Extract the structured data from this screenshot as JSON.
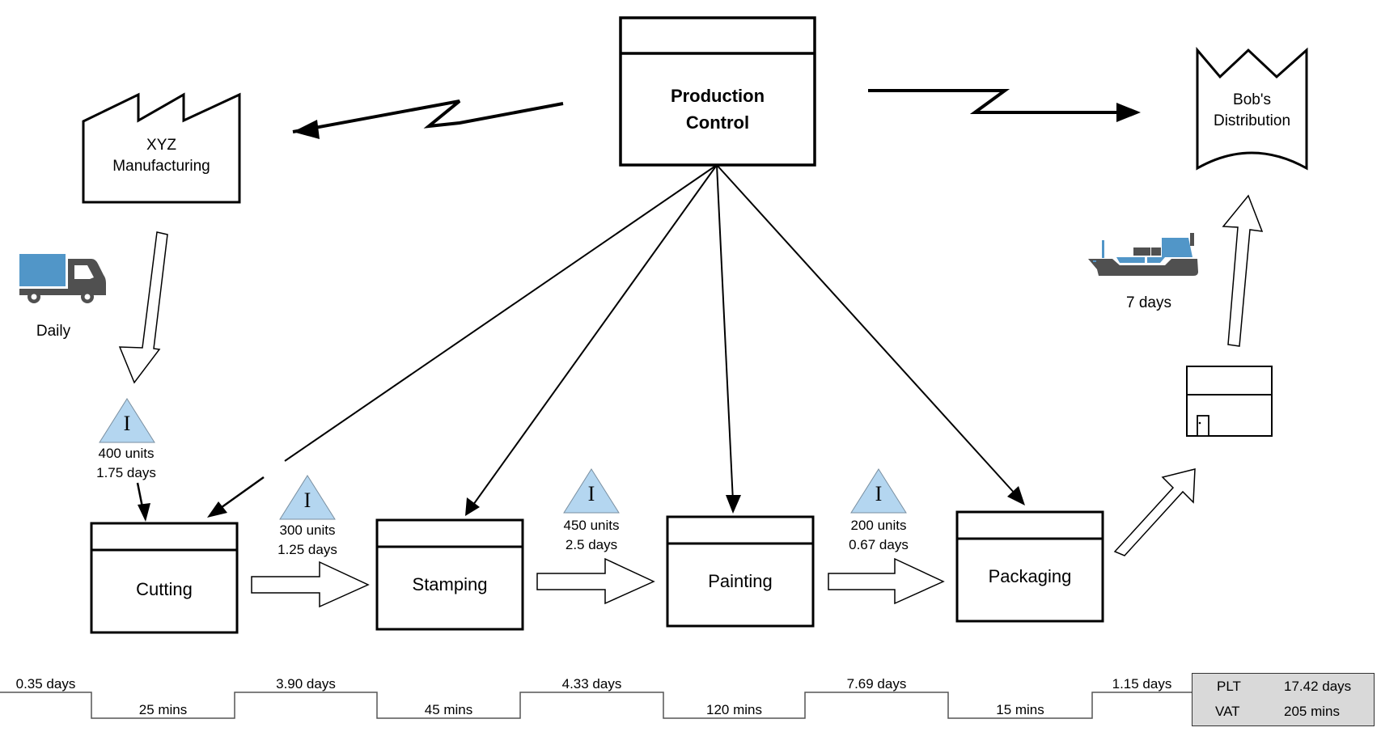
{
  "diagram": {
    "type": "value-stream-map",
    "colors": {
      "inventory_fill": "#b4d6f0",
      "truck_box": "#5196c8",
      "icon_dark": "#505050",
      "summary_bg": "#d9d9d9"
    }
  },
  "supplier": {
    "name_line1": "XYZ",
    "name_line2": "Manufacturing",
    "icon": "factory-icon"
  },
  "production_control": {
    "line1": "Production",
    "line2": "Control"
  },
  "customer": {
    "name_line1": "Bob's",
    "name_line2": "Distribution",
    "icon": "customer-icon"
  },
  "inbound_shipment": {
    "icon": "truck-icon",
    "frequency": "Daily"
  },
  "outbound_shipment": {
    "icon": "ship-icon",
    "duration": "7 days"
  },
  "warehouse": {
    "icon": "warehouse-icon"
  },
  "processes": [
    {
      "name": "Cutting"
    },
    {
      "name": "Stamping"
    },
    {
      "name": "Painting"
    },
    {
      "name": "Packaging"
    }
  ],
  "inventories": [
    {
      "symbol": "I",
      "units": "400 units",
      "days": "1.75 days"
    },
    {
      "symbol": "I",
      "units": "300 units",
      "days": "1.25 days"
    },
    {
      "symbol": "I",
      "units": "450 units",
      "days": "2.5 days"
    },
    {
      "symbol": "I",
      "units": "200 units",
      "days": "0.67 days"
    }
  ],
  "timeline": {
    "wait_times": [
      "0.35 days",
      "3.90 days",
      "4.33 days",
      "7.69 days",
      "1.15 days"
    ],
    "process_times": [
      "25 mins",
      "45 mins",
      "120 mins",
      "15 mins"
    ]
  },
  "summary": {
    "plt_label": "PLT",
    "plt_value": "17.42 days",
    "vat_label": "VAT",
    "vat_value": "205 mins"
  }
}
